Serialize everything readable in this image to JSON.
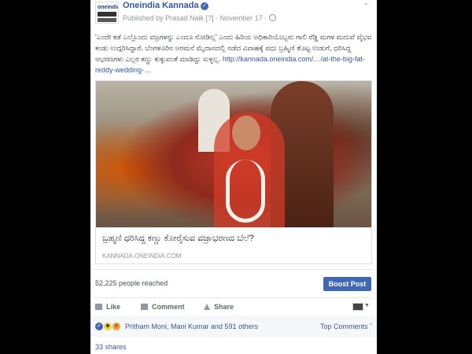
{
  "post": {
    "page_name": "Oneindia Kannada",
    "published_by": "Published by Prasad Naik",
    "help_mark": "[?]",
    "date": "November 17",
    "text": "'ಎಂದೇ ಕಡೆ ಎಲ್ಲೊಂದು ವಜ್ರಗಳನ್ನು ಎಂದೂ ನೋಡಿಲ್ಲ' ಎಂದು ಹಿರಿಯ ಅಧಿಕಾರಿಯೊಬ್ಬರು ಗಾಲಿ ರೆಡ್ಡಿ ಮಗಳ ಮದುವೆ ವೈಭವ ಕಂಡು ಉದ್ಗರಿಸಿದ್ದಾರೆ. ಬೆಂಗಳೂರಿನ ಅರಮನೆ ಮೈದಾನದಲ್ಲಿ ನಡೆದ ವಿವಾಹಕ್ಕೆ ವಧು ಬ್ರಹ್ಮಿಣಿ ತೊಟ್ಟ ಉಡುಗೆ, ಧರಿಸಿದ್ದ ಆಭರಣಗಳು ಎಲ್ಲರ ಕಣ್ಣು ಕುಕ್ಕುವಂತೆ ಮಾಡಿದ್ದು ಸುಳ್ಳಲ್ಲ.",
    "link_text": "http://kannada.oneindia.com/…/at-the-big-fat-reddy-wedding-…"
  },
  "link_preview": {
    "title": "ಬ್ರಹ್ಮಣಿ ಧರಿಸಿದ್ದ ಕಣ್ಣು ಕೋರೈಸುವ ವಜ್ರಾಭರಣದ ಬೆಲೆ?",
    "domain": "KANNADA.ONEINDIA.COM"
  },
  "stats": {
    "reached": "52,225 people reached",
    "boost_label": "Boost Post"
  },
  "actions": {
    "like": "Like",
    "comment": "Comment",
    "share": "Share"
  },
  "reactions": {
    "names": "Pritham Moni, Mani Kumar and 591 others",
    "top_comments": "Top Comments ˇ",
    "shares": "33 shares"
  },
  "colors": {
    "link_blue": "#365899",
    "boost_blue": "#4267b2",
    "page_bg": "#000000"
  }
}
